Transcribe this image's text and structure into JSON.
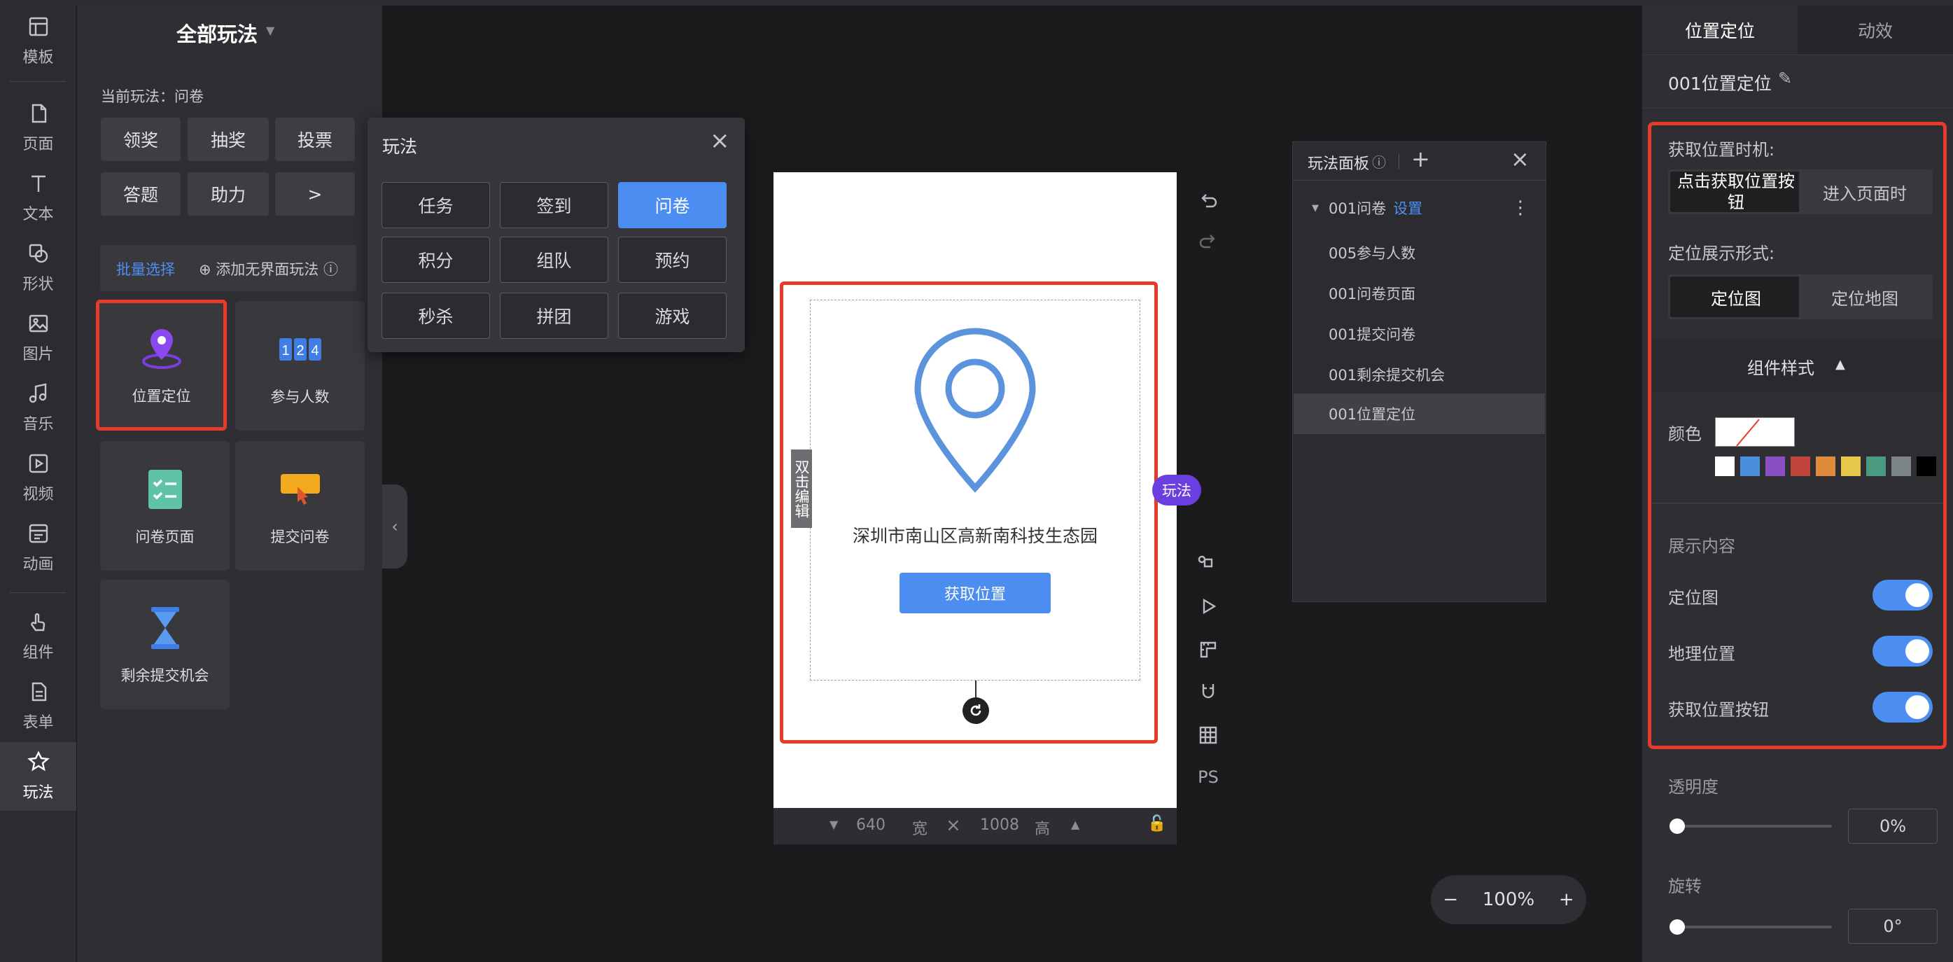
{
  "rail": [
    {
      "label": "模板",
      "icon": "template-icon"
    },
    {
      "label": "页面",
      "icon": "page-icon"
    },
    {
      "label": "文本",
      "icon": "text-icon"
    },
    {
      "label": "形状",
      "icon": "shape-icon"
    },
    {
      "label": "图片",
      "icon": "image-icon"
    },
    {
      "label": "音乐",
      "icon": "music-icon"
    },
    {
      "label": "视频",
      "icon": "video-icon"
    },
    {
      "label": "动画",
      "icon": "animation-icon"
    },
    {
      "label": "组件",
      "icon": "component-icon"
    },
    {
      "label": "表单",
      "icon": "form-icon"
    },
    {
      "label": "玩法",
      "icon": "gameplay-icon"
    }
  ],
  "panel": {
    "title": "全部玩法",
    "current": "当前玩法：问卷",
    "quick_buttons": [
      "领奖",
      "抽奖",
      "投票",
      "答题",
      "助力",
      ">"
    ],
    "batch_select": "批量选择",
    "add_uiless": "添加无界面玩法",
    "cards": [
      {
        "label": "位置定位",
        "icon": "location-pin-icon"
      },
      {
        "label": "参与人数",
        "icon": "counter-icon"
      },
      {
        "label": "问卷页面",
        "icon": "checklist-icon"
      },
      {
        "label": "提交问卷",
        "icon": "submit-icon"
      },
      {
        "label": "剩余提交机会",
        "icon": "hourglass-icon"
      }
    ]
  },
  "popup": {
    "title": "玩法",
    "options": [
      "任务",
      "签到",
      "问卷",
      "积分",
      "组队",
      "预约",
      "秒杀",
      "拼团",
      "游戏"
    ],
    "selected": "问卷"
  },
  "canvas": {
    "address": "深圳市南山区高新南科技生态园",
    "button": "获取位置",
    "double_click_edit": "双击编辑",
    "badge": "玩法",
    "width": "640",
    "width_unit": "宽",
    "height": "1008",
    "height_unit": "高",
    "tools": [
      "command-icon",
      "play-icon",
      "ruler-icon",
      "magnet-icon",
      "grid-icon",
      "PS"
    ]
  },
  "layers": {
    "title": "玩法面板",
    "group": "001问卷",
    "group_link": "设置",
    "items": [
      "005参与人数",
      "001问卷页面",
      "001提交问卷",
      "001剩余提交机会",
      "001位置定位"
    ],
    "selected": "001位置定位"
  },
  "right": {
    "tabs": [
      "位置定位",
      "动效"
    ],
    "component_name": "001位置定位",
    "timing_label": "获取位置时机:",
    "timing_options": [
      "点击获取位置按钮",
      "进入页面时"
    ],
    "display_label": "定位展示形式:",
    "display_options": [
      "定位图",
      "定位地图"
    ],
    "style_section": "组件样式",
    "color_label": "颜色",
    "swatches": [
      "#ffffff",
      "#4a8fd9",
      "#8a4fc2",
      "#c0453c",
      "#e08a3c",
      "#e8c84a",
      "#4a9a82",
      "#7d8486",
      "#000000"
    ],
    "content_label": "展示内容",
    "toggles": [
      {
        "label": "定位图",
        "on": true
      },
      {
        "label": "地理位置",
        "on": true
      },
      {
        "label": "获取位置按钮",
        "on": true
      }
    ],
    "opacity_label": "透明度",
    "opacity_value": "0%",
    "opacity": 0,
    "rotation_label": "旋转",
    "rotation_value": "0°",
    "rotation": 0
  },
  "zoom": {
    "value": "100%",
    "minus": "−",
    "plus": "+"
  },
  "colors": {
    "accent": "#4b8df0",
    "highlight": "#e83a2a",
    "badge": "#6b3ee0"
  }
}
